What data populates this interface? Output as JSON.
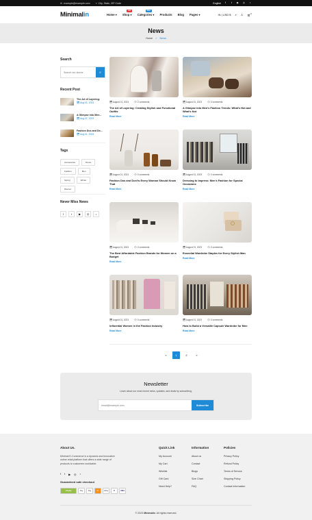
{
  "topbar": {
    "email": "example@example.com",
    "location": "City, State, ZIP Code",
    "language": "English"
  },
  "header": {
    "logo_main": "Minimal",
    "logo_accent": "in",
    "nav": [
      {
        "label": "Home",
        "badge": "",
        "badge_color": ""
      },
      {
        "label": "Shop",
        "badge": "Hot",
        "badge_color": "#e53935"
      },
      {
        "label": "Categories",
        "badge": "New",
        "badge_color": "#1f8ad6"
      },
      {
        "label": "Products",
        "badge": "",
        "badge_color": ""
      },
      {
        "label": "Blog",
        "badge": "",
        "badge_color": ""
      },
      {
        "label": "Pages",
        "badge": "",
        "badge_color": ""
      }
    ],
    "currency": "IN | USD $",
    "cart_count": "0"
  },
  "banner": {
    "title": "News",
    "crumb_home": "Home",
    "crumb_sep": ">",
    "crumb_current": "News"
  },
  "sidebar": {
    "search_title": "Search",
    "search_placeholder": "Search our stores",
    "recent_title": "Recent Post",
    "recent": [
      {
        "title": "The Art of Layering:",
        "date": "Aug 01, 2023"
      },
      {
        "title": "A Glimpse into Men...",
        "date": "Aug 01, 2023"
      },
      {
        "title": "Fashion Dos and Do...",
        "date": "Aug 01, 2023"
      }
    ],
    "tags_title": "Tags",
    "tags": [
      "Accessories",
      "Dress",
      "Fashion",
      "Men",
      "Spring",
      "Winter",
      "Women"
    ],
    "never_miss_title": "Never Miss News"
  },
  "posts": [
    {
      "date": "August 01, 2023",
      "comments": "2 comments",
      "title": "The Art of Layering: Creating Stylish and Functional Outfits",
      "read": "Read More"
    },
    {
      "date": "August 01, 2023",
      "comments": "0 comments",
      "title": "A Glimpse into Men's Fashion Trends: What's Hot and What's Not",
      "read": "Read More"
    },
    {
      "date": "August 01, 2023",
      "comments": "0 comments",
      "title": "Fashion Dos and Don'ts Every Woman Should Know That",
      "read": "Read More"
    },
    {
      "date": "August 01, 2023",
      "comments": "0 comments",
      "title": "Dressing to Impress: Men's Fashion for Special Occasions",
      "read": "Read More"
    },
    {
      "date": "August 01, 2023",
      "comments": "0 comments",
      "title": "The Best Affordable Fashion Brands for Women on a Budget",
      "read": "Read More"
    },
    {
      "date": "August 01, 2023",
      "comments": "0 comments",
      "title": "Essential Wardrobe Staples for Every Stylish Man",
      "read": "Read More"
    },
    {
      "date": "August 01, 2023",
      "comments": "0 comments",
      "title": "Influential Women in the Fashion Industry",
      "read": "Read More"
    },
    {
      "date": "August 01, 2023",
      "comments": "0 comments",
      "title": "How to Build a Versatile Capsule Wardrobe for Men",
      "read": "Read More"
    }
  ],
  "pagination": {
    "prev": "«",
    "p1": "1",
    "p2": "2",
    "next": "»"
  },
  "newsletter": {
    "title": "Newsletter",
    "desc": "Learn about our most recent news, updates, and deals by subscribing.",
    "placeholder": "email@example.com",
    "button": "Subscribe"
  },
  "footer": {
    "about_title": "About Us.",
    "about_text": "Minimal E-Commerce is a dynamic and innovative online retail platform that offers a wide range of products to customers worldwide.",
    "guaranteed": "Guaranteed safe checkout",
    "payments": [
      "shopify",
      "Pay",
      "Pay",
      "B",
      "GPay",
      "P",
      "VISA"
    ],
    "quick_title": "Quick Link",
    "quick": [
      "My Account",
      "My Cart",
      "Wishlist",
      "Gift Card",
      "Need Help?"
    ],
    "info_title": "Information",
    "info": [
      "About us",
      "Contact",
      "Blogs",
      "Size Chart",
      "FAQ"
    ],
    "policies_title": "Policies",
    "policies": [
      "Privacy Policy",
      "Refund Policy",
      "Terms of Service",
      "Shipping Policy",
      "Contact Information"
    ],
    "copyright_pre": "© 2023",
    "copyright_brand": "Minimalin",
    "copyright_post": ". All rights reserved."
  },
  "colors": {
    "accent": "#1f8ad6",
    "dark": "#111111",
    "banner_bg": "#ebebeb"
  }
}
